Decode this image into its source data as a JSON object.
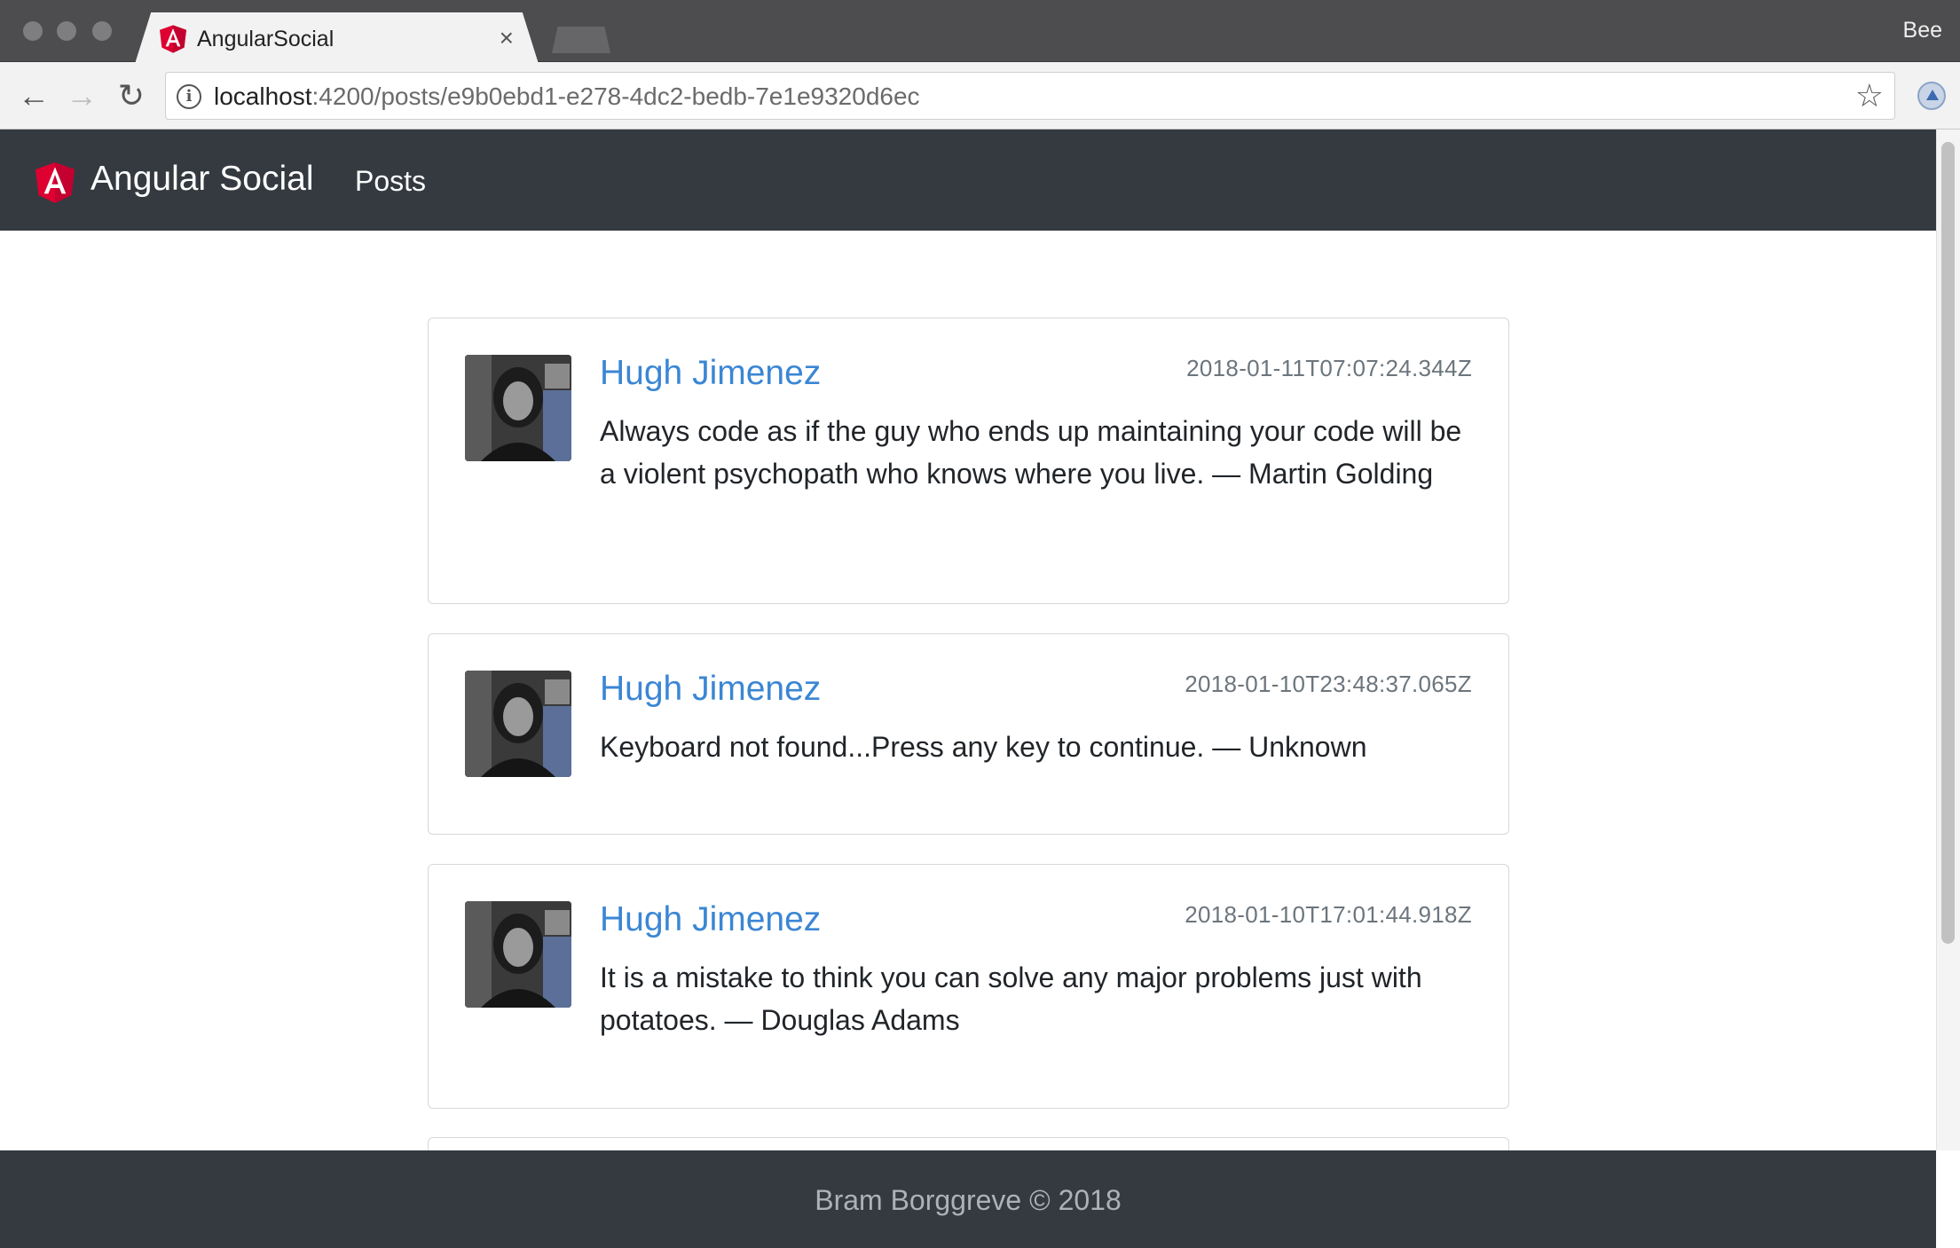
{
  "browser": {
    "tab_title": "AngularSocial",
    "tab_close": "×",
    "profile_label": "Bee",
    "url_host": "localhost",
    "url_rest": ":4200/posts/e9b0ebd1-e278-4dc2-bedb-7e1e9320d6ec"
  },
  "navbar": {
    "brand": "Angular Social",
    "links": [
      {
        "label": "Posts"
      }
    ]
  },
  "posts": [
    {
      "author": "Hugh Jimenez",
      "timestamp": "2018-01-11T07:07:24.344Z",
      "message": "Always code as if the guy who ends up maintaining your code will be a violent psychopath who knows where you live. — Martin Golding"
    },
    {
      "author": "Hugh Jimenez",
      "timestamp": "2018-01-10T23:48:37.065Z",
      "message": "Keyboard not found...Press any key to continue. — Unknown"
    },
    {
      "author": "Hugh Jimenez",
      "timestamp": "2018-01-10T17:01:44.918Z",
      "message": "It is a mistake to think you can solve any major problems just with potatoes. — Douglas Adams"
    }
  ],
  "footer": {
    "text": "Bram Borggreve © 2018"
  },
  "colors": {
    "navbar_bg": "#343a40",
    "author_link": "#3b86d4",
    "angular_red": "#dd0031"
  },
  "icons": [
    "angular-logo-icon",
    "back-arrow-icon",
    "forward-arrow-icon",
    "reload-icon",
    "info-icon",
    "star-icon",
    "close-icon"
  ]
}
